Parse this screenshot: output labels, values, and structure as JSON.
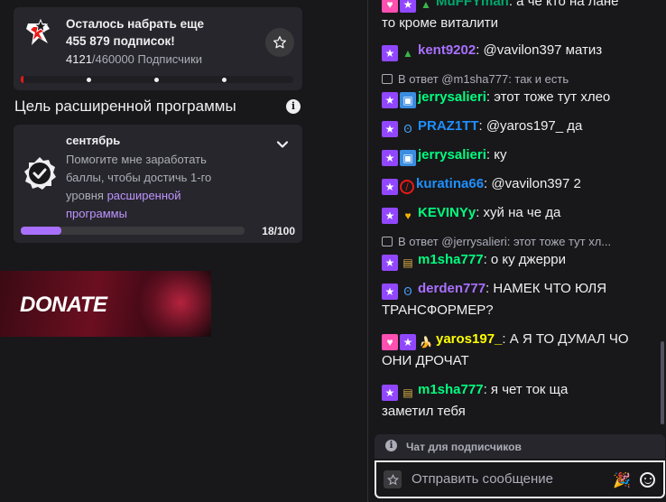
{
  "subs_goal": {
    "title_line1": "Осталось набрать еще",
    "title_line2": "455 879 подписок!",
    "current": "4121",
    "target": "/460000",
    "label": " Подписчики",
    "progress_fraction": 0.009
  },
  "hype": {
    "header": "Цель расширенной программы",
    "month": "сентябрь",
    "desc_plain": "Помогите мне заработать баллы, чтобы достичь 1-го уровня ",
    "desc_link": "расширенной программы",
    "count": "18/100",
    "progress_fraction": 0.18
  },
  "donate": {
    "label": "DONATE"
  },
  "chat": {
    "messages": [
      {
        "badges": [
          "heart",
          "sub",
          "grass"
        ],
        "user": "MuFFYman",
        "color": "#00a86b",
        "text": ": а че кто на лане",
        "cont": "то кроме виталити"
      },
      {
        "badges": [
          "sub",
          "grass"
        ],
        "user": "kent9202",
        "color": "#a970ff",
        "text": ": @vavilon397 матиз"
      },
      {
        "reply": "В ответ @m1sha777: так и есть"
      },
      {
        "badges": [
          "sub",
          "gift"
        ],
        "user": "jerrysalieri",
        "color": "#00ff7f",
        "text": ": этот тоже тут хлео"
      },
      {
        "badges": [
          "sub",
          "bunny"
        ],
        "user": "PRAZ1TT",
        "color": "#1e90ff",
        "text": ": @yaros197_ да"
      },
      {
        "badges": [
          "sub",
          "gift"
        ],
        "user": "jerrysalieri",
        "color": "#00ff7f",
        "text": ": ку"
      },
      {
        "badges": [
          "sub",
          "nosub"
        ],
        "user": "kuratina66",
        "color": "#1e90ff",
        "text": ": @vavilon397 2"
      },
      {
        "badges": [
          "sub",
          "heart2"
        ],
        "user": "KEVINYy",
        "color": "#00ff7f",
        "text": ": хуй на че да"
      },
      {
        "reply": "В ответ @jerrysalieri: этот тоже тут хл..."
      },
      {
        "badges": [
          "sub",
          "chest"
        ],
        "user": "m1sha777",
        "color": "#00ff7f",
        "text": ": о ку джерри"
      },
      {
        "badges": [
          "sub",
          "bunny"
        ],
        "user": "derden777",
        "color": "#a970ff",
        "text": ": НАМЕК ЧТО ЮЛЯ",
        "cont": "ТРАНСФОРМЕР?"
      },
      {
        "badges": [
          "heart",
          "sub",
          "banana"
        ],
        "user": "yaros197_",
        "color": "#ffff00",
        "text": ": А Я ТО ДУМАЛ ЧО",
        "cont": "ОНИ ДРОЧАТ"
      },
      {
        "badges": [
          "sub",
          "chest"
        ],
        "user": "m1sha777",
        "color": "#00ff7f",
        "text": ": я чет ток ща",
        "cont": "заметил тебя"
      }
    ],
    "sub_only_label": "Чат для подписчиков",
    "input_placeholder": "Отправить сообщение"
  }
}
